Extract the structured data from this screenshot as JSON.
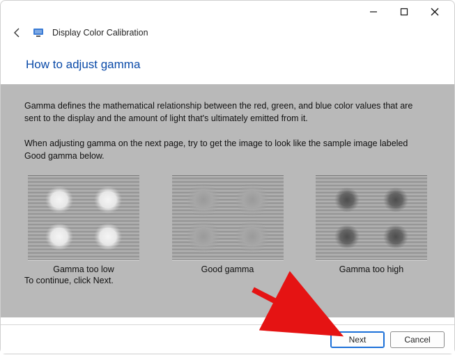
{
  "window": {
    "app_title": "Display Color Calibration"
  },
  "heading": "How to adjust gamma",
  "body": {
    "p1": "Gamma defines the mathematical relationship between the red, green, and blue color values that are sent to the display and the amount of light that's ultimately emitted from it.",
    "p2": "When adjusting gamma on the next page, try to get the image to look like the sample image labeled Good gamma below.",
    "continue": "To continue, click Next."
  },
  "samples": {
    "low": "Gamma too low",
    "good": "Good gamma",
    "high": "Gamma too high"
  },
  "buttons": {
    "next": "Next",
    "cancel": "Cancel"
  },
  "icons": {
    "back": "back-arrow-icon",
    "minimize": "minimize-icon",
    "maximize": "maximize-icon",
    "close": "close-icon",
    "app": "display-calibration-icon"
  }
}
